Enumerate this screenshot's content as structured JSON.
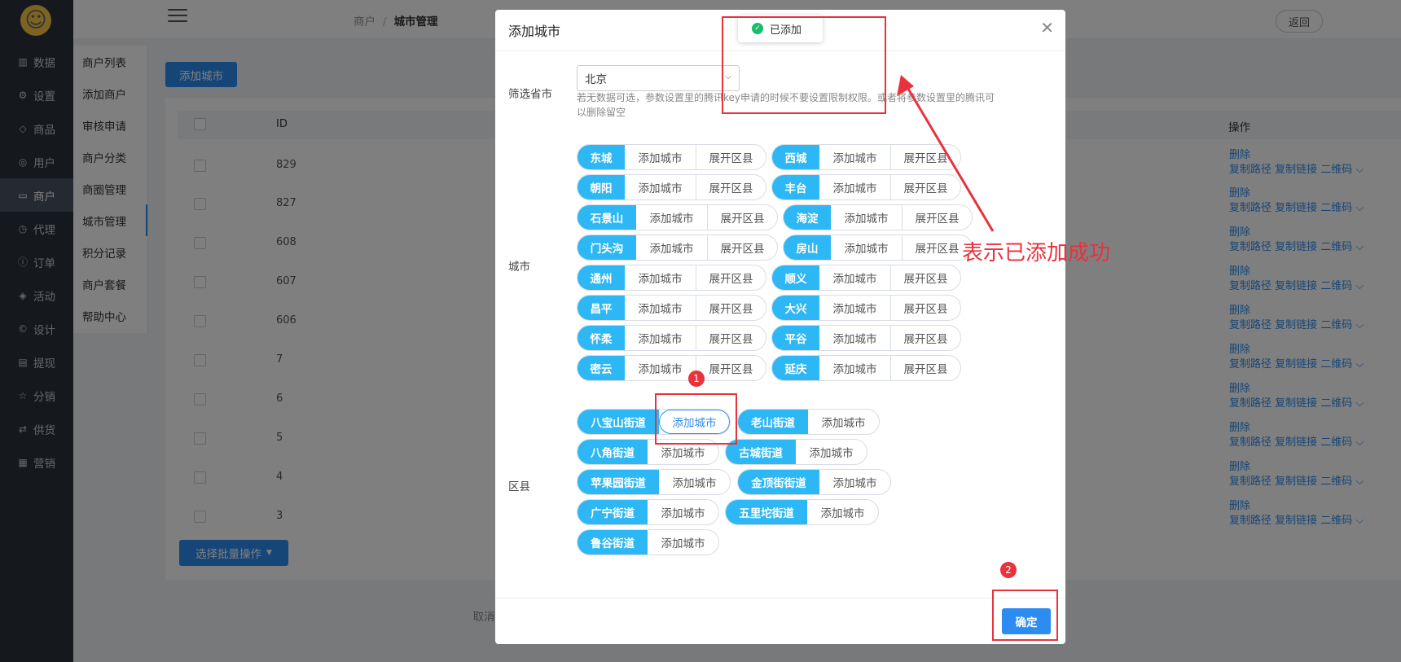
{
  "header": {
    "breadcrumb": [
      "商户",
      "城市管理"
    ],
    "back_label": "返回"
  },
  "sidebar": {
    "items": [
      {
        "label": "数据",
        "icon": "bar-chart-icon"
      },
      {
        "label": "设置",
        "icon": "gear-icon"
      },
      {
        "label": "商品",
        "icon": "box-icon"
      },
      {
        "label": "用户",
        "icon": "user-icon"
      },
      {
        "label": "商户",
        "icon": "shop-icon",
        "active": true
      },
      {
        "label": "代理",
        "icon": "clock-icon"
      },
      {
        "label": "订单",
        "icon": "info-icon"
      },
      {
        "label": "活动",
        "icon": "tag-icon"
      },
      {
        "label": "设计",
        "icon": "palette-icon"
      },
      {
        "label": "提现",
        "icon": "wallet-icon"
      },
      {
        "label": "分销",
        "icon": "star-icon"
      },
      {
        "label": "供货",
        "icon": "exchange-icon"
      },
      {
        "label": "营销",
        "icon": "grid-icon"
      }
    ]
  },
  "subnav": {
    "items": [
      "商户列表",
      "添加商户",
      "审核申请",
      "商户分类",
      "商圈管理",
      "城市管理",
      "积分记录",
      "商户套餐",
      "帮助中心"
    ],
    "active_index": 5
  },
  "content": {
    "add_city_label": "添加城市",
    "table": {
      "headers": [
        "ID",
        "操作"
      ],
      "ids": [
        "829",
        "827",
        "608",
        "607",
        "606",
        "7",
        "6",
        "5",
        "4",
        "3"
      ],
      "op_delete": "删除",
      "op_links": "复制路径 复制链接 二维码"
    },
    "batch_label": "选择批量操作"
  },
  "modal": {
    "title": "添加城市",
    "filter_label": "筛选省市",
    "province_selected": "北京",
    "help_text": "若无数据可选，参数设置里的腾讯key申请的时候不要设置限制权限。或者将参数设置里的腾讯可以删除留空",
    "city_label": "城市",
    "district_label": "区县",
    "add_label": "添加城市",
    "expand_label": "展开区县",
    "cities": [
      "东城",
      "西城",
      "朝阳",
      "丰台",
      "石景山",
      "海淀",
      "门头沟",
      "房山",
      "通州",
      "顺义",
      "昌平",
      "大兴",
      "怀柔",
      "平谷",
      "密云",
      "延庆"
    ],
    "districts": [
      "八宝山街道",
      "老山街道",
      "八角街道",
      "古城街道",
      "苹果园街道",
      "金顶街街道",
      "广宁街道",
      "五里坨街道",
      "鲁谷街道"
    ],
    "cancel_label": "取消",
    "confirm_label": "确定"
  },
  "toast": {
    "text": "已添加"
  },
  "annotations": {
    "note": "表示已添加成功",
    "badge1": "1",
    "badge2": "2",
    "color": "#e8323c"
  }
}
